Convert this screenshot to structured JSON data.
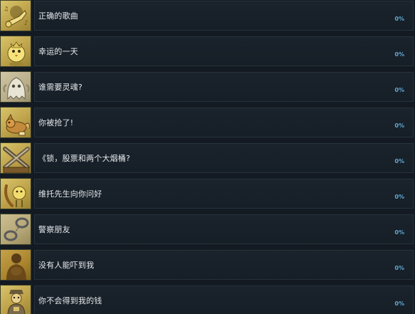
{
  "achievements": [
    {
      "title": "正确的歌曲",
      "percent": "0%",
      "icon": "trumpet-icon"
    },
    {
      "title": "幸运的一天",
      "percent": "0%",
      "icon": "chick-icon"
    },
    {
      "title": "谁需要灵魂?",
      "percent": "0%",
      "icon": "ghost-icon"
    },
    {
      "title": "你被抢了!",
      "percent": "0%",
      "icon": "fox-icon"
    },
    {
      "title": "《锁，股票和两个大烟桶?",
      "percent": "0%",
      "icon": "crossed-guns-icon"
    },
    {
      "title": "维托先生向你问好",
      "percent": "0%",
      "icon": "banana-icon"
    },
    {
      "title": "警察朋友",
      "percent": "0%",
      "icon": "handcuffs-icon"
    },
    {
      "title": "没有人能吓到我",
      "percent": "0%",
      "icon": "shadow-figure-icon"
    },
    {
      "title": "你不会得到我的钱",
      "percent": "0%",
      "icon": "old-man-icon"
    }
  ],
  "colors": {
    "background": "#131a22",
    "panel": "#1a232c",
    "title_text": "#e6e9ec",
    "percent_text": "#62a8d6",
    "icon_gold": "#cdb45a"
  }
}
